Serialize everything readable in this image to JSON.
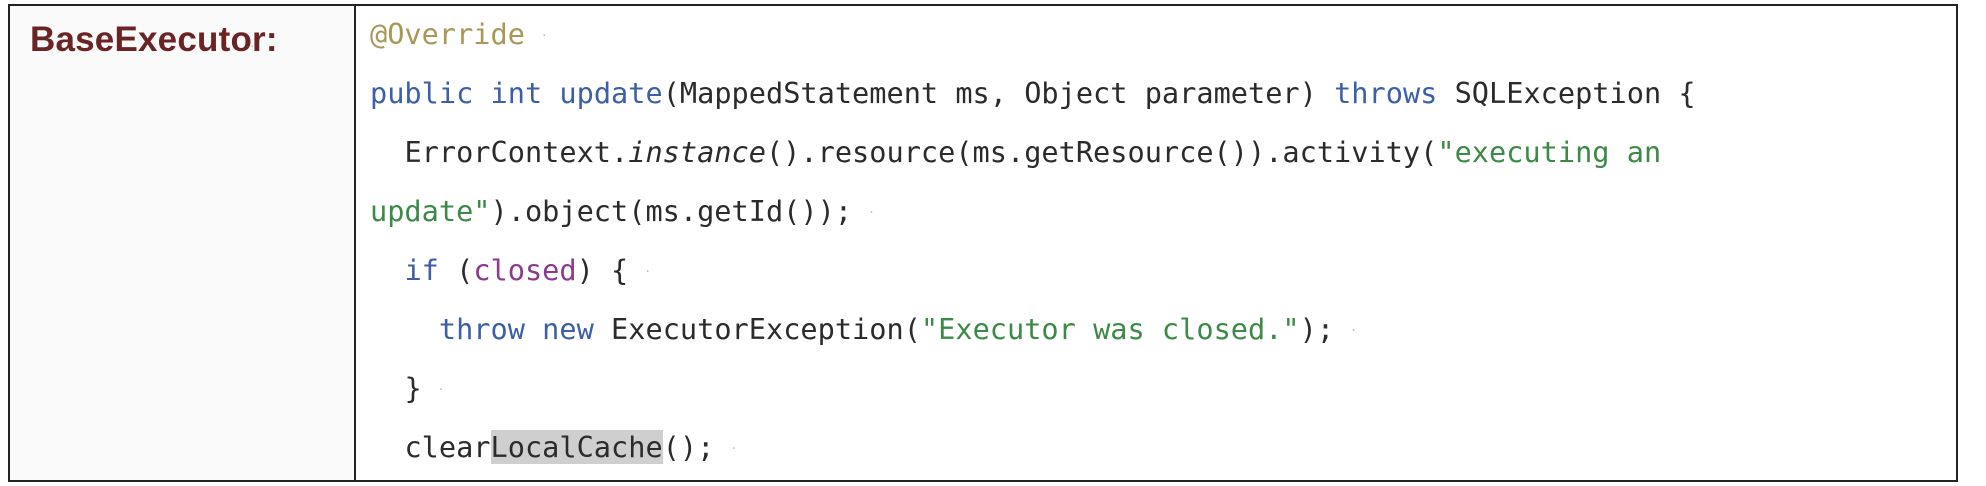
{
  "label": "BaseExecutor:",
  "code": {
    "l1": {
      "annotation": "@Override"
    },
    "l2": {
      "kw_public": "public",
      "kw_int": "int",
      "method": "update",
      "params": "(MappedStatement ms, Object parameter) ",
      "kw_throws": "throws",
      "tail": " SQLException {"
    },
    "l3": {
      "pre": "ErrorContext.",
      "italic": "instance",
      "mid": "().resource(ms.getResource()).activity(",
      "str": "\"executing an"
    },
    "l4": {
      "str": "update\"",
      "rest": ").object(ms.getId());"
    },
    "l5": {
      "kw_if": "if",
      "open": " (",
      "field": "closed",
      "close": ") {"
    },
    "l6": {
      "kw_throw": "throw",
      "kw_new": "new",
      "cls": " ExecutorException(",
      "str": "\"Executor was closed.\"",
      "end": ");"
    },
    "l7": {
      "brace": "}"
    },
    "l8": {
      "pre": "clear",
      "highlight": "LocalCache",
      "post": "();"
    }
  },
  "colors": {
    "label": "#6b2424",
    "keyword": "#3d5fa8",
    "string": "#3b8a46",
    "annotation": "#a89757",
    "field": "#8b3a8e",
    "highlight": "#cfcfcf"
  }
}
